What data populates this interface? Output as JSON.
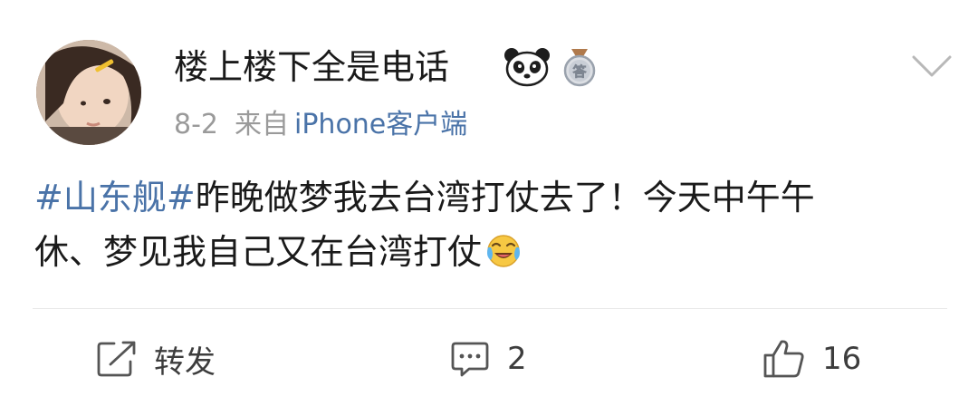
{
  "post": {
    "username": "楼上楼下全是电话",
    "date": "8-2",
    "source_prefix": "来自",
    "client": "iPhone客户端",
    "hashtag": "#山东舰#",
    "body_line1": "昨晚做梦我去台湾打仗去了！今天中午午",
    "body_line2": "休、梦见我自己又在台湾打仗"
  },
  "badges": {
    "medal_char": "答"
  },
  "icons": {
    "avatar": "avatar-photo",
    "panda": "panda-badge-icon",
    "medal": "medal-badge-icon",
    "more": "chevron-down-icon",
    "emoji": "crying-laughing-emoji-icon",
    "repost": "share-icon",
    "comment": "comment-icon",
    "like": "thumbs-up-icon"
  },
  "actions": {
    "repost_label": "转发",
    "comment_count": "2",
    "like_count": "16"
  },
  "colors": {
    "link": "#4a73a8",
    "meta": "#9a9a9a",
    "text": "#1a1a1a"
  }
}
